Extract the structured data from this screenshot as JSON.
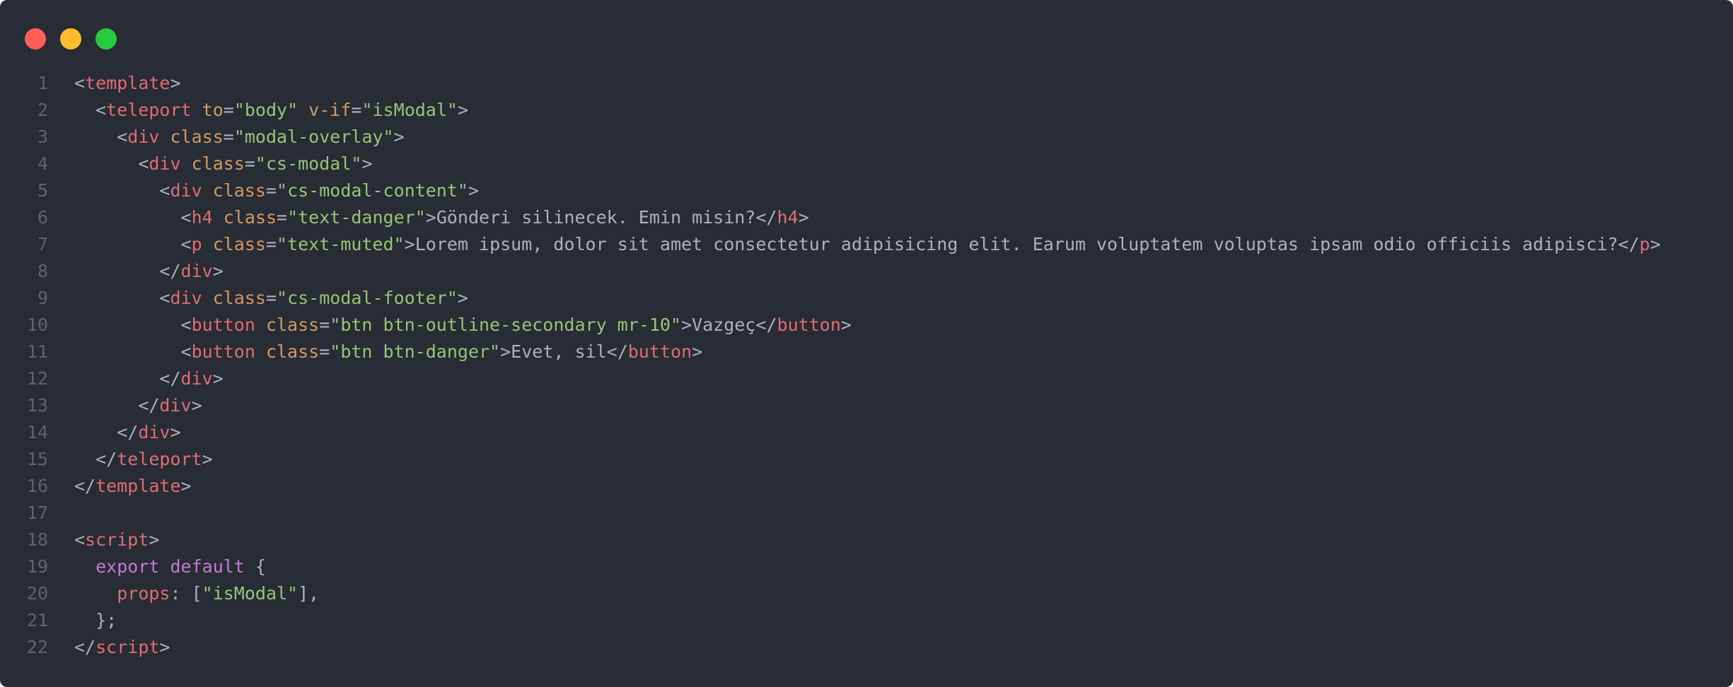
{
  "window": {
    "background": "#282c34",
    "traffic_lights": [
      {
        "name": "close",
        "color": "#ff5f56"
      },
      {
        "name": "minimize",
        "color": "#ffbd2e"
      },
      {
        "name": "maximize",
        "color": "#27c93f"
      }
    ]
  },
  "colors": {
    "tag": "#e06c75",
    "attr": "#d19a66",
    "string": "#98c379",
    "keyword": "#c678dd",
    "text": "#abb2bf",
    "line_number": "#5c6370"
  },
  "code": {
    "lines": [
      {
        "n": "1",
        "tokens": [
          {
            "t": "punct",
            "v": "<"
          },
          {
            "t": "tag",
            "v": "template"
          },
          {
            "t": "punct",
            "v": ">"
          }
        ]
      },
      {
        "n": "2",
        "tokens": [
          {
            "t": "text",
            "v": "  "
          },
          {
            "t": "punct",
            "v": "<"
          },
          {
            "t": "tag",
            "v": "teleport"
          },
          {
            "t": "text",
            "v": " "
          },
          {
            "t": "attr",
            "v": "to"
          },
          {
            "t": "punct",
            "v": "="
          },
          {
            "t": "str",
            "v": "\"body\""
          },
          {
            "t": "text",
            "v": " "
          },
          {
            "t": "attr",
            "v": "v-if"
          },
          {
            "t": "punct",
            "v": "="
          },
          {
            "t": "str",
            "v": "\"isModal\""
          },
          {
            "t": "punct",
            "v": ">"
          }
        ]
      },
      {
        "n": "3",
        "tokens": [
          {
            "t": "text",
            "v": "    "
          },
          {
            "t": "punct",
            "v": "<"
          },
          {
            "t": "tag",
            "v": "div"
          },
          {
            "t": "text",
            "v": " "
          },
          {
            "t": "attr",
            "v": "class"
          },
          {
            "t": "punct",
            "v": "="
          },
          {
            "t": "str",
            "v": "\"modal-overlay\""
          },
          {
            "t": "punct",
            "v": ">"
          }
        ]
      },
      {
        "n": "4",
        "tokens": [
          {
            "t": "text",
            "v": "      "
          },
          {
            "t": "punct",
            "v": "<"
          },
          {
            "t": "tag",
            "v": "div"
          },
          {
            "t": "text",
            "v": " "
          },
          {
            "t": "attr",
            "v": "class"
          },
          {
            "t": "punct",
            "v": "="
          },
          {
            "t": "str",
            "v": "\"cs-modal\""
          },
          {
            "t": "punct",
            "v": ">"
          }
        ]
      },
      {
        "n": "5",
        "tokens": [
          {
            "t": "text",
            "v": "        "
          },
          {
            "t": "punct",
            "v": "<"
          },
          {
            "t": "tag",
            "v": "div"
          },
          {
            "t": "text",
            "v": " "
          },
          {
            "t": "attr",
            "v": "class"
          },
          {
            "t": "punct",
            "v": "="
          },
          {
            "t": "str",
            "v": "\"cs-modal-content\""
          },
          {
            "t": "punct",
            "v": ">"
          }
        ]
      },
      {
        "n": "6",
        "tokens": [
          {
            "t": "text",
            "v": "          "
          },
          {
            "t": "punct",
            "v": "<"
          },
          {
            "t": "tag",
            "v": "h4"
          },
          {
            "t": "text",
            "v": " "
          },
          {
            "t": "attr",
            "v": "class"
          },
          {
            "t": "punct",
            "v": "="
          },
          {
            "t": "str",
            "v": "\"text-danger\""
          },
          {
            "t": "punct",
            "v": ">"
          },
          {
            "t": "text",
            "v": "Gönderi silinecek. Emin misin?"
          },
          {
            "t": "punct",
            "v": "</"
          },
          {
            "t": "tag",
            "v": "h4"
          },
          {
            "t": "punct",
            "v": ">"
          }
        ]
      },
      {
        "n": "7",
        "tokens": [
          {
            "t": "text",
            "v": "          "
          },
          {
            "t": "punct",
            "v": "<"
          },
          {
            "t": "tag",
            "v": "p"
          },
          {
            "t": "text",
            "v": " "
          },
          {
            "t": "attr",
            "v": "class"
          },
          {
            "t": "punct",
            "v": "="
          },
          {
            "t": "str",
            "v": "\"text-muted\""
          },
          {
            "t": "punct",
            "v": ">"
          },
          {
            "t": "text",
            "v": "Lorem ipsum, dolor sit amet consectetur adipisicing elit. Earum voluptatem voluptas ipsam odio officiis adipisci?"
          },
          {
            "t": "punct",
            "v": "</"
          },
          {
            "t": "tag",
            "v": "p"
          },
          {
            "t": "punct",
            "v": ">"
          }
        ]
      },
      {
        "n": "8",
        "tokens": [
          {
            "t": "text",
            "v": "        "
          },
          {
            "t": "punct",
            "v": "</"
          },
          {
            "t": "tag",
            "v": "div"
          },
          {
            "t": "punct",
            "v": ">"
          }
        ]
      },
      {
        "n": "9",
        "tokens": [
          {
            "t": "text",
            "v": "        "
          },
          {
            "t": "punct",
            "v": "<"
          },
          {
            "t": "tag",
            "v": "div"
          },
          {
            "t": "text",
            "v": " "
          },
          {
            "t": "attr",
            "v": "class"
          },
          {
            "t": "punct",
            "v": "="
          },
          {
            "t": "str",
            "v": "\"cs-modal-footer\""
          },
          {
            "t": "punct",
            "v": ">"
          }
        ]
      },
      {
        "n": "10",
        "tokens": [
          {
            "t": "text",
            "v": "          "
          },
          {
            "t": "punct",
            "v": "<"
          },
          {
            "t": "tag",
            "v": "button"
          },
          {
            "t": "text",
            "v": " "
          },
          {
            "t": "attr",
            "v": "class"
          },
          {
            "t": "punct",
            "v": "="
          },
          {
            "t": "str",
            "v": "\"btn btn-outline-secondary mr-10\""
          },
          {
            "t": "punct",
            "v": ">"
          },
          {
            "t": "text",
            "v": "Vazgeç"
          },
          {
            "t": "punct",
            "v": "</"
          },
          {
            "t": "tag",
            "v": "button"
          },
          {
            "t": "punct",
            "v": ">"
          }
        ]
      },
      {
        "n": "11",
        "tokens": [
          {
            "t": "text",
            "v": "          "
          },
          {
            "t": "punct",
            "v": "<"
          },
          {
            "t": "tag",
            "v": "button"
          },
          {
            "t": "text",
            "v": " "
          },
          {
            "t": "attr",
            "v": "class"
          },
          {
            "t": "punct",
            "v": "="
          },
          {
            "t": "str",
            "v": "\"btn btn-danger\""
          },
          {
            "t": "punct",
            "v": ">"
          },
          {
            "t": "text",
            "v": "Evet, sil"
          },
          {
            "t": "punct",
            "v": "</"
          },
          {
            "t": "tag",
            "v": "button"
          },
          {
            "t": "punct",
            "v": ">"
          }
        ]
      },
      {
        "n": "12",
        "tokens": [
          {
            "t": "text",
            "v": "        "
          },
          {
            "t": "punct",
            "v": "</"
          },
          {
            "t": "tag",
            "v": "div"
          },
          {
            "t": "punct",
            "v": ">"
          }
        ]
      },
      {
        "n": "13",
        "tokens": [
          {
            "t": "text",
            "v": "      "
          },
          {
            "t": "punct",
            "v": "</"
          },
          {
            "t": "tag",
            "v": "div"
          },
          {
            "t": "punct",
            "v": ">"
          }
        ]
      },
      {
        "n": "14",
        "tokens": [
          {
            "t": "text",
            "v": "    "
          },
          {
            "t": "punct",
            "v": "</"
          },
          {
            "t": "tag",
            "v": "div"
          },
          {
            "t": "punct",
            "v": ">"
          }
        ]
      },
      {
        "n": "15",
        "tokens": [
          {
            "t": "text",
            "v": "  "
          },
          {
            "t": "punct",
            "v": "</"
          },
          {
            "t": "tag",
            "v": "teleport"
          },
          {
            "t": "punct",
            "v": ">"
          }
        ]
      },
      {
        "n": "16",
        "tokens": [
          {
            "t": "punct",
            "v": "</"
          },
          {
            "t": "tag",
            "v": "template"
          },
          {
            "t": "punct",
            "v": ">"
          }
        ]
      },
      {
        "n": "17",
        "tokens": []
      },
      {
        "n": "18",
        "tokens": [
          {
            "t": "punct",
            "v": "<"
          },
          {
            "t": "tag",
            "v": "script"
          },
          {
            "t": "punct",
            "v": ">"
          }
        ]
      },
      {
        "n": "19",
        "tokens": [
          {
            "t": "text",
            "v": "  "
          },
          {
            "t": "kw",
            "v": "export"
          },
          {
            "t": "text",
            "v": " "
          },
          {
            "t": "kw",
            "v": "default"
          },
          {
            "t": "text",
            "v": " {"
          }
        ]
      },
      {
        "n": "20",
        "tokens": [
          {
            "t": "text",
            "v": "    "
          },
          {
            "t": "prop",
            "v": "props"
          },
          {
            "t": "punct",
            "v": ": ["
          },
          {
            "t": "str",
            "v": "\"isModal\""
          },
          {
            "t": "punct",
            "v": "],"
          }
        ]
      },
      {
        "n": "21",
        "tokens": [
          {
            "t": "text",
            "v": "  };"
          }
        ]
      },
      {
        "n": "22",
        "tokens": [
          {
            "t": "punct",
            "v": "</"
          },
          {
            "t": "tag",
            "v": "script"
          },
          {
            "t": "punct",
            "v": ">"
          }
        ]
      }
    ]
  }
}
